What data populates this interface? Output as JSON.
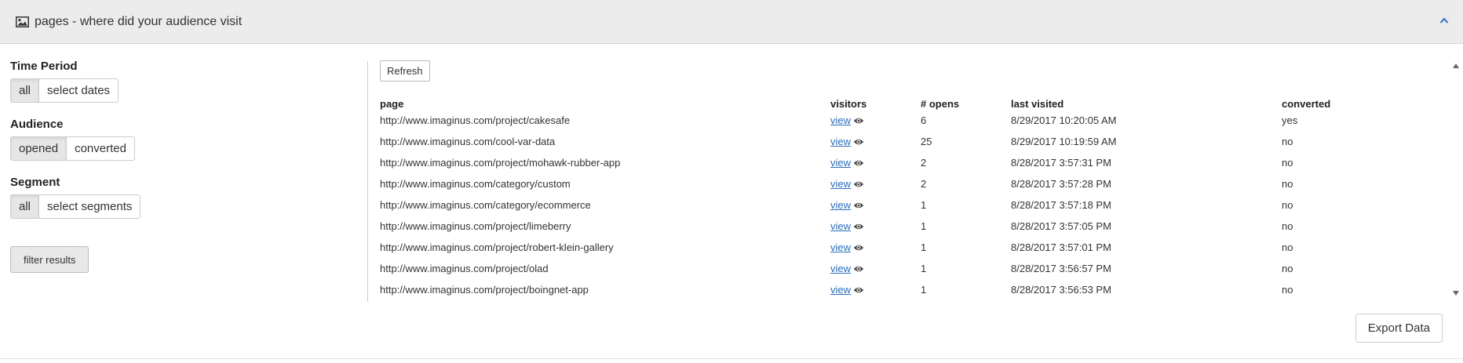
{
  "header": {
    "title": "pages - where did your audience visit",
    "icon": "image-icon",
    "collapse_icon": "chevron-up-icon",
    "accent_color": "#2a6ebb"
  },
  "filters": {
    "time_period": {
      "label": "Time Period",
      "options": [
        "all",
        "select dates"
      ],
      "selected": "all"
    },
    "audience": {
      "label": "Audience",
      "options": [
        "opened",
        "converted"
      ],
      "selected": "opened"
    },
    "segment": {
      "label": "Segment",
      "options": [
        "all",
        "select segments"
      ],
      "selected": "all"
    },
    "filter_button": "filter results"
  },
  "results": {
    "refresh_label": "Refresh",
    "columns": [
      "page",
      "visitors",
      "# opens",
      "last visited",
      "converted"
    ],
    "rows": [
      {
        "page": "http://www.imaginus.com/project/cakesafe",
        "visitors": "view",
        "opens": "6",
        "last_visited": "8/29/2017 10:20:05 AM",
        "converted": "yes"
      },
      {
        "page": "http://www.imaginus.com/cool-var-data",
        "visitors": "view",
        "opens": "25",
        "last_visited": "8/29/2017 10:19:59 AM",
        "converted": "no"
      },
      {
        "page": "http://www.imaginus.com/project/mohawk-rubber-app",
        "visitors": "view",
        "opens": "2",
        "last_visited": "8/28/2017 3:57:31 PM",
        "converted": "no"
      },
      {
        "page": "http://www.imaginus.com/category/custom",
        "visitors": "view",
        "opens": "2",
        "last_visited": "8/28/2017 3:57:28 PM",
        "converted": "no"
      },
      {
        "page": "http://www.imaginus.com/category/ecommerce",
        "visitors": "view",
        "opens": "1",
        "last_visited": "8/28/2017 3:57:18 PM",
        "converted": "no"
      },
      {
        "page": "http://www.imaginus.com/project/limeberry",
        "visitors": "view",
        "opens": "1",
        "last_visited": "8/28/2017 3:57:05 PM",
        "converted": "no"
      },
      {
        "page": "http://www.imaginus.com/project/robert-klein-gallery",
        "visitors": "view",
        "opens": "1",
        "last_visited": "8/28/2017 3:57:01 PM",
        "converted": "no"
      },
      {
        "page": "http://www.imaginus.com/project/olad",
        "visitors": "view",
        "opens": "1",
        "last_visited": "8/28/2017 3:56:57 PM",
        "converted": "no"
      },
      {
        "page": "http://www.imaginus.com/project/boingnet-app",
        "visitors": "view",
        "opens": "1",
        "last_visited": "8/28/2017 3:56:53 PM",
        "converted": "no"
      }
    ],
    "export_label": "Export Data"
  }
}
